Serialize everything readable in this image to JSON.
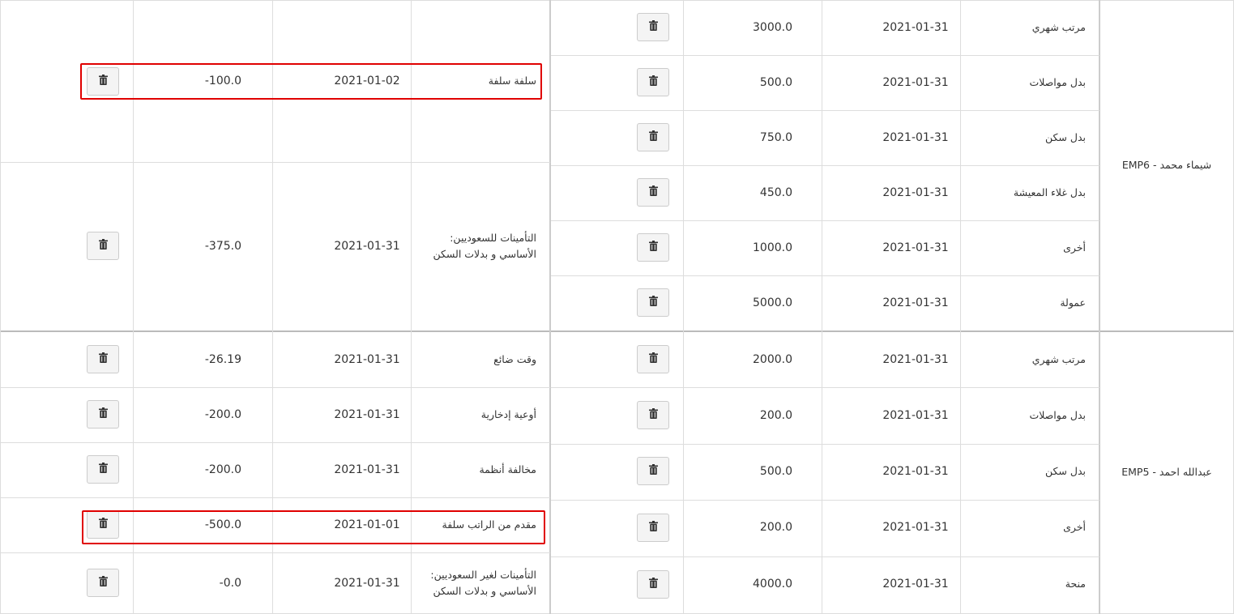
{
  "employees": [
    {
      "label": "EMP6 - شيماء محمد",
      "earnings": [
        {
          "name": "مرتب شهري",
          "date": "2021-01-31",
          "amount": "3000.0"
        },
        {
          "name": "بدل مواصلات",
          "date": "2021-01-31",
          "amount": "500.0"
        },
        {
          "name": "بدل سكن",
          "date": "2021-01-31",
          "amount": "750.0"
        },
        {
          "name": "بدل غلاء المعيشة",
          "date": "2021-01-31",
          "amount": "450.0"
        },
        {
          "name": "أخرى",
          "date": "2021-01-31",
          "amount": "1000.0"
        },
        {
          "name": "عمولة",
          "date": "2021-01-31",
          "amount": "5000.0"
        }
      ],
      "deductions": [
        {
          "name": "سلفة سلفة",
          "date": "2021-01-02",
          "amount": "-100.0",
          "highlighted": true
        },
        {
          "name_line1": "التأمينات للسعوديين:",
          "name_line2": "الأساسي و بدلات السكن",
          "date": "2021-01-31",
          "amount": "-375.0"
        }
      ]
    },
    {
      "label": "EMP5 - عبدالله احمد",
      "earnings": [
        {
          "name": "مرتب شهري",
          "date": "2021-01-31",
          "amount": "2000.0"
        },
        {
          "name": "بدل مواصلات",
          "date": "2021-01-31",
          "amount": "200.0"
        },
        {
          "name": "بدل سكن",
          "date": "2021-01-31",
          "amount": "500.0"
        },
        {
          "name": "أخرى",
          "date": "2021-01-31",
          "amount": "200.0"
        },
        {
          "name": "منحة",
          "date": "2021-01-31",
          "amount": "4000.0"
        }
      ],
      "deductions": [
        {
          "name": "وقت ضائع",
          "date": "2021-01-31",
          "amount": "-26.19"
        },
        {
          "name": "أوعية إدخارية",
          "date": "2021-01-31",
          "amount": "-200.0"
        },
        {
          "name": "مخالفة أنظمة",
          "date": "2021-01-31",
          "amount": "-200.0"
        },
        {
          "name": "مقدم من الراتب سلفة",
          "date": "2021-01-01",
          "amount": "-500.0",
          "highlighted": true
        },
        {
          "name_line1": "التأمينات لغير السعوديين:",
          "name_line2": "الأساسي و بدلات السكن",
          "date": "2021-01-31",
          "amount": "-0.0"
        }
      ]
    }
  ],
  "icons": {
    "delete": "trash-icon"
  },
  "colors": {
    "highlight": "#e00000",
    "border": "#dddddd",
    "button_bg": "#f4f4f4"
  }
}
